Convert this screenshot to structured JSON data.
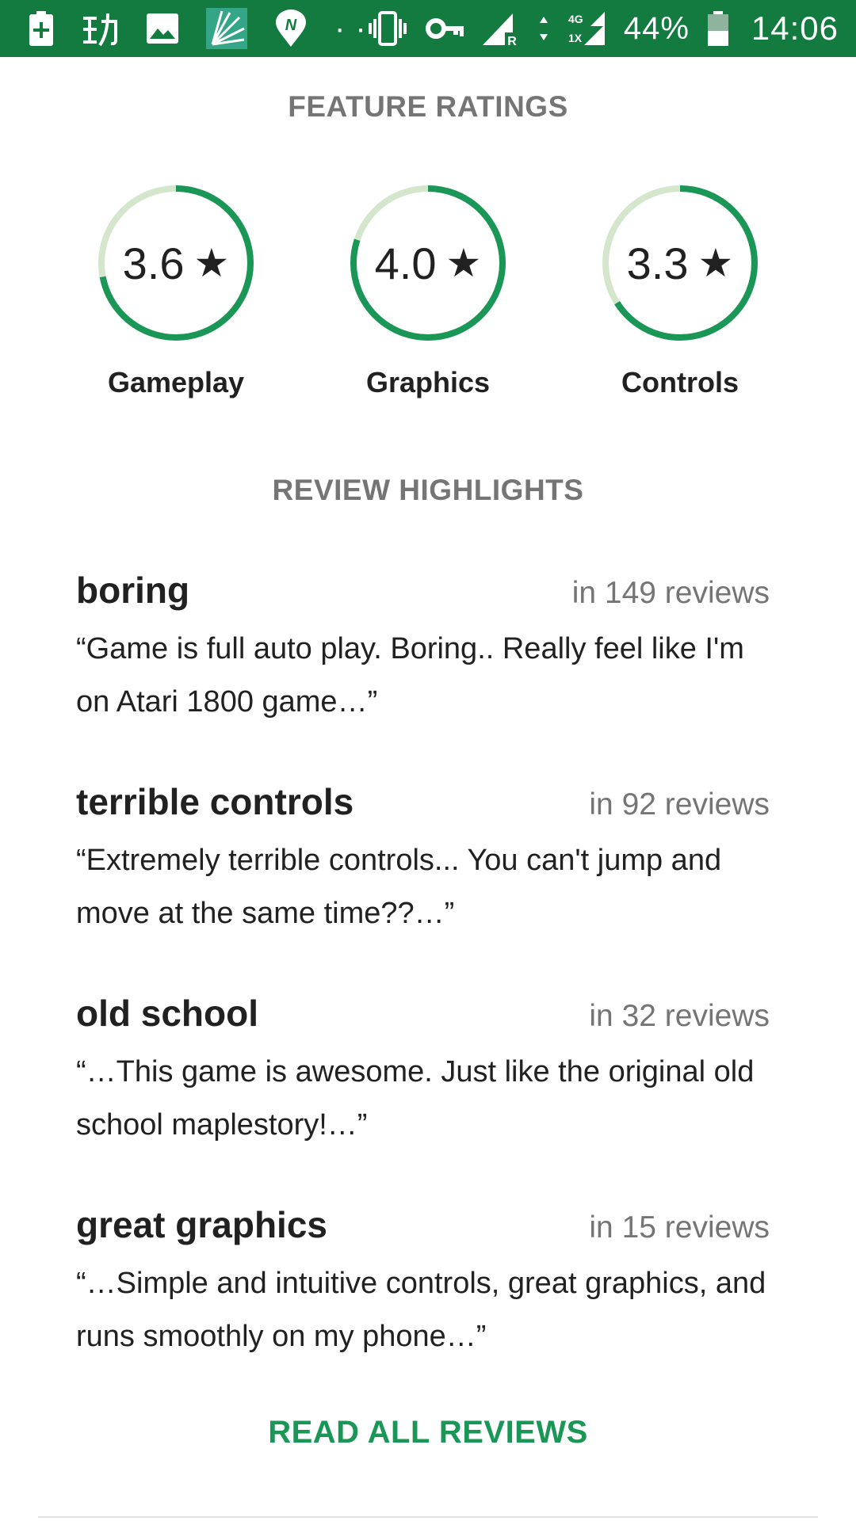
{
  "status_bar": {
    "battery_percent": "44%",
    "clock": "14:06",
    "network_label_top": "4G",
    "network_label_bottom": "1X",
    "roaming_label": "R",
    "dots": "· ·",
    "icons": [
      "battery-saver-icon",
      "chinese-app-icon",
      "gallery-icon",
      "burst-app-icon",
      "navigation-app-icon",
      "vibrate-icon",
      "vpn-key-icon",
      "signal-icon",
      "network-signal-icon",
      "battery-icon"
    ],
    "accent": "#137a40"
  },
  "feature_ratings": {
    "title": "FEATURE RATINGS",
    "items": [
      {
        "value": "3.6",
        "rating": 3.6,
        "label": "Gameplay"
      },
      {
        "value": "4.0",
        "rating": 4.0,
        "label": "Graphics"
      },
      {
        "value": "3.3",
        "rating": 3.3,
        "label": "Controls"
      }
    ],
    "max_rating": 5,
    "ring_color": "#1a9656",
    "ring_track_color": "#d4e6cc"
  },
  "review_highlights": {
    "title": "REVIEW HIGHLIGHTS",
    "items": [
      {
        "phrase": "boring",
        "count": "in 149 reviews",
        "quote": "“Game is full auto play. Boring.. Really feel like I'm on Atari 1800 game…”"
      },
      {
        "phrase": "terrible controls",
        "count": "in 92 reviews",
        "quote": "“Extremely terrible controls... You can't jump and move at the same time??…”"
      },
      {
        "phrase": "old school",
        "count": "in 32 reviews",
        "quote": "“…This game is awesome. Just like the original old school maplestory!…”"
      },
      {
        "phrase": "great graphics",
        "count": "in 15 reviews",
        "quote": "“…Simple and intuitive controls, great graphics, and runs smoothly on my phone…”"
      }
    ]
  },
  "read_all_label": "READ ALL REVIEWS",
  "link_color": "#1a9656"
}
